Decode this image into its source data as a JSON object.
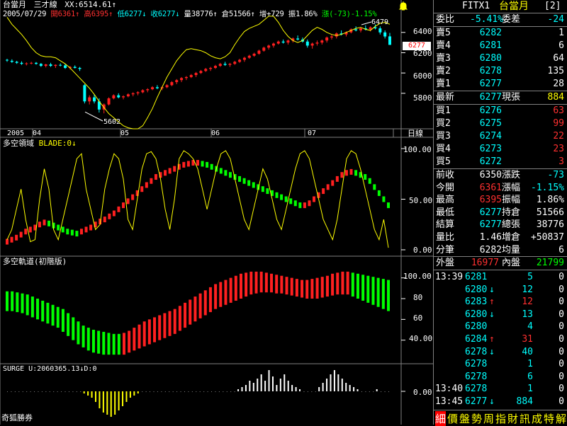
{
  "header": {
    "title": "台當月",
    "indicator": "三才線",
    "xx": "XX:6514.61↑",
    "date": "2005/07/29",
    "open": "開6361↑",
    "high": "高6395↑",
    "low": "低6277↓",
    "close": "收6277↓",
    "volume": "量38776↑",
    "oi": "倉51566↑",
    "oi_chg": "增+729",
    "amplitude": "振1.86%",
    "change": "漲(-73)-1.15%",
    "alert_icon": "bell-icon"
  },
  "price_chart": {
    "ymin": 5450,
    "ymax": 6580,
    "ticks": [
      "6400",
      "6200",
      "6000",
      "5800"
    ],
    "tick_values": [
      6400,
      6200,
      6000,
      5800
    ],
    "current_price": "6277",
    "high_label": "6479",
    "low_label": "5602",
    "months": [
      "2005",
      "04",
      "05",
      "06",
      "07"
    ],
    "period": "日線",
    "candles": [
      [
        6130,
        6140,
        6110,
        6125
      ],
      [
        6120,
        6135,
        6100,
        6110
      ],
      [
        6110,
        6120,
        6090,
        6100
      ],
      [
        6100,
        6115,
        6080,
        6090
      ],
      [
        6090,
        6105,
        6075,
        6095
      ],
      [
        6095,
        6110,
        6085,
        6100
      ],
      [
        6100,
        6108,
        6082,
        6090
      ],
      [
        6090,
        6098,
        6060,
        6070
      ],
      [
        6070,
        6090,
        6055,
        6085
      ],
      [
        6085,
        6100,
        6060,
        6070
      ],
      [
        6070,
        6085,
        6050,
        6080
      ],
      [
        6080,
        6095,
        6065,
        6075
      ],
      [
        6075,
        6090,
        6040,
        6050
      ],
      [
        6050,
        6070,
        6035,
        6060
      ],
      [
        6060,
        6075,
        6045,
        6050
      ],
      [
        6050,
        6060,
        6020,
        6040
      ],
      [
        5880,
        5890,
        5700,
        5720
      ],
      [
        5720,
        5780,
        5690,
        5760
      ],
      [
        5760,
        5790,
        5700,
        5720
      ],
      [
        5720,
        5750,
        5610,
        5640
      ],
      [
        5640,
        5700,
        5602,
        5690
      ],
      [
        5690,
        5760,
        5680,
        5750
      ],
      [
        5750,
        5790,
        5740,
        5780
      ],
      [
        5780,
        5800,
        5750,
        5760
      ],
      [
        5760,
        5780,
        5740,
        5770
      ],
      [
        5770,
        5800,
        5760,
        5790
      ],
      [
        5790,
        5810,
        5770,
        5800
      ],
      [
        5800,
        5820,
        5780,
        5810
      ],
      [
        5810,
        5840,
        5800,
        5830
      ],
      [
        5830,
        5850,
        5810,
        5840
      ],
      [
        5840,
        5870,
        5830,
        5860
      ],
      [
        5860,
        5880,
        5840,
        5850
      ],
      [
        5850,
        5870,
        5830,
        5860
      ],
      [
        5860,
        5890,
        5850,
        5880
      ],
      [
        5880,
        5920,
        5870,
        5910
      ],
      [
        5910,
        5940,
        5890,
        5930
      ],
      [
        5930,
        5960,
        5910,
        5950
      ],
      [
        5950,
        5970,
        5930,
        5960
      ],
      [
        5960,
        5990,
        5950,
        5980
      ],
      [
        5980,
        6010,
        5960,
        6000
      ],
      [
        6000,
        6030,
        5990,
        6020
      ],
      [
        6020,
        6050,
        6010,
        6040
      ],
      [
        6040,
        6060,
        6020,
        6050
      ],
      [
        6050,
        6080,
        6040,
        6070
      ],
      [
        6070,
        6100,
        6060,
        6090
      ],
      [
        6090,
        6110,
        6070,
        6080
      ],
      [
        6080,
        6100,
        6060,
        6090
      ],
      [
        6090,
        6120,
        6080,
        6110
      ],
      [
        6110,
        6140,
        6100,
        6130
      ],
      [
        6130,
        6160,
        6110,
        6150
      ],
      [
        6150,
        6180,
        6140,
        6170
      ],
      [
        6170,
        6200,
        6160,
        6190
      ],
      [
        6190,
        6230,
        6180,
        6220
      ],
      [
        6220,
        6260,
        6210,
        6250
      ],
      [
        6250,
        6280,
        6230,
        6270
      ],
      [
        6270,
        6300,
        6250,
        6290
      ],
      [
        6290,
        6320,
        6280,
        6310
      ],
      [
        6310,
        6330,
        6290,
        6300
      ],
      [
        6300,
        6330,
        6280,
        6320
      ],
      [
        6320,
        6350,
        6300,
        6340
      ],
      [
        6340,
        6370,
        6320,
        6330
      ],
      [
        6330,
        6350,
        6300,
        6310
      ],
      [
        6310,
        6330,
        6250,
        6270
      ],
      [
        6270,
        6300,
        6240,
        6290
      ],
      [
        6290,
        6320,
        6270,
        6300
      ],
      [
        6300,
        6330,
        6280,
        6320
      ],
      [
        6320,
        6360,
        6300,
        6350
      ],
      [
        6350,
        6380,
        6330,
        6360
      ],
      [
        6360,
        6400,
        6340,
        6390
      ],
      [
        6390,
        6420,
        6370,
        6380
      ],
      [
        6380,
        6410,
        6360,
        6400
      ],
      [
        6400,
        6440,
        6390,
        6430
      ],
      [
        6430,
        6460,
        6410,
        6420
      ],
      [
        6420,
        6450,
        6400,
        6440
      ],
      [
        6440,
        6470,
        6420,
        6430
      ],
      [
        6430,
        6460,
        6410,
        6450
      ],
      [
        6450,
        6479,
        6430,
        6440
      ],
      [
        6440,
        6460,
        6380,
        6400
      ],
      [
        6400,
        6420,
        6340,
        6360
      ],
      [
        6361,
        6395,
        6277,
        6277
      ]
    ],
    "ma_line": [
      6550,
      6480,
      6430,
      6380,
      6320,
      6250,
      6200,
      6170,
      6160,
      6160,
      6150,
      6120,
      6090,
      6050,
      6000,
      5950,
      5900,
      5850,
      5790,
      5720,
      5660,
      5600,
      5560,
      5520,
      5480,
      5460,
      5450,
      5450,
      5480,
      5560,
      5650,
      5760,
      5860,
      5960,
      6040,
      6120,
      6180,
      6230,
      6240,
      6230,
      6220,
      6200,
      6170,
      6150,
      6140,
      6160,
      6200,
      6280,
      6350,
      6410,
      6440,
      6460,
      6480,
      6520,
      6560,
      6560,
      6500,
      6420,
      6360,
      6320,
      6300,
      6320,
      6370,
      6420,
      6450,
      6430,
      6400,
      6380,
      6370,
      6380,
      6400,
      6420,
      6440,
      6450,
      6430,
      6420,
      6460,
      6490,
      6500,
      6480
    ]
  },
  "blade_chart": {
    "title": "多空領域",
    "param": "BLADE:0↓",
    "ticks": [
      "100.00",
      "50.00",
      "0.00"
    ],
    "tick_values": [
      100,
      50,
      0
    ],
    "dots": [
      8,
      10,
      12,
      15,
      18,
      20,
      22,
      25,
      27,
      26,
      24,
      22,
      20,
      18,
      17,
      16,
      18,
      20,
      22,
      25,
      28,
      30,
      33,
      36,
      40,
      44,
      48,
      52,
      56,
      60,
      64,
      68,
      72,
      74,
      76,
      78,
      80,
      82,
      84,
      85,
      86,
      86,
      85,
      84,
      82,
      80,
      78,
      76,
      74,
      72,
      70,
      68,
      66,
      64,
      62,
      60,
      58,
      56,
      54,
      52,
      50,
      48,
      46,
      44,
      44,
      46,
      50,
      54,
      58,
      62,
      66,
      70,
      74,
      76,
      77,
      76,
      74,
      72,
      68,
      62,
      56,
      50,
      44
    ],
    "line": [
      10,
      20,
      40,
      60,
      30,
      8,
      10,
      50,
      80,
      60,
      20,
      10,
      30,
      50,
      70,
      90,
      95,
      60,
      40,
      20,
      25,
      60,
      80,
      95,
      90,
      70,
      30,
      20,
      50,
      80,
      95,
      97,
      90,
      70,
      40,
      20,
      50,
      90,
      98,
      95,
      90,
      80,
      60,
      40,
      60,
      80,
      95,
      98,
      90,
      70,
      50,
      30,
      20,
      40,
      60,
      80,
      70,
      50,
      30,
      20,
      40,
      60,
      80,
      95,
      98,
      90,
      70,
      50,
      30,
      20,
      10,
      30,
      60,
      90,
      98,
      95,
      80,
      60,
      40,
      20,
      10,
      30,
      2
    ]
  },
  "track_chart": {
    "title": "多空軌道(初階版)",
    "ticks": [
      "100.00",
      "80",
      "60",
      "40.00"
    ],
    "tick_values": [
      100,
      80,
      60,
      40
    ],
    "bars": [
      [
        87,
        68
      ],
      [
        87,
        68
      ],
      [
        86,
        67
      ],
      [
        85,
        66
      ],
      [
        84,
        64
      ],
      [
        82,
        62
      ],
      [
        80,
        60
      ],
      [
        78,
        58
      ],
      [
        76,
        56
      ],
      [
        74,
        54
      ],
      [
        72,
        52
      ],
      [
        70,
        48
      ],
      [
        66,
        44
      ],
      [
        62,
        40
      ],
      [
        58,
        36
      ],
      [
        54,
        33
      ],
      [
        52,
        30
      ],
      [
        50,
        28
      ],
      [
        49,
        27
      ],
      [
        48,
        26
      ],
      [
        47,
        26
      ],
      [
        46,
        26
      ],
      [
        46,
        26
      ],
      [
        47,
        26
      ],
      [
        49,
        28
      ],
      [
        52,
        30
      ],
      [
        55,
        32
      ],
      [
        58,
        34
      ],
      [
        60,
        36
      ],
      [
        62,
        38
      ],
      [
        64,
        40
      ],
      [
        66,
        42
      ],
      [
        68,
        44
      ],
      [
        70,
        46
      ],
      [
        73,
        49
      ],
      [
        76,
        52
      ],
      [
        79,
        55
      ],
      [
        82,
        58
      ],
      [
        85,
        61
      ],
      [
        88,
        64
      ],
      [
        91,
        67
      ],
      [
        94,
        70
      ],
      [
        96,
        72
      ],
      [
        98,
        74
      ],
      [
        100,
        76
      ],
      [
        102,
        78
      ],
      [
        104,
        80
      ],
      [
        105,
        82
      ],
      [
        106,
        84
      ],
      [
        106,
        85
      ],
      [
        106,
        86
      ],
      [
        105,
        86
      ],
      [
        104,
        86
      ],
      [
        103,
        85
      ],
      [
        102,
        85
      ],
      [
        101,
        84
      ],
      [
        100,
        83
      ],
      [
        99,
        82
      ],
      [
        98,
        81
      ],
      [
        98,
        80
      ],
      [
        99,
        80
      ],
      [
        100,
        80
      ],
      [
        101,
        81
      ],
      [
        102,
        82
      ],
      [
        104,
        83
      ],
      [
        105,
        84
      ],
      [
        106,
        84
      ],
      [
        106,
        84
      ],
      [
        105,
        82
      ],
      [
        104,
        80
      ],
      [
        103,
        78
      ],
      [
        102,
        76
      ],
      [
        101,
        74
      ],
      [
        100,
        72
      ],
      [
        99,
        70
      ],
      [
        98,
        68
      ]
    ],
    "colors_split": [
      23,
      68
    ]
  },
  "surge_chart": {
    "title": "SURGE",
    "param": "U:2060365.13↓D:0",
    "zero_label": "0.00",
    "vals": [
      0,
      0,
      0,
      0,
      0,
      0,
      0,
      0,
      0,
      0,
      0,
      0,
      0,
      0,
      0,
      0,
      0,
      0,
      0,
      0,
      -1,
      -2,
      -3,
      -5,
      -8,
      -10,
      -11,
      -12,
      -11,
      -9,
      -7,
      -5,
      -3,
      -2,
      -1,
      0,
      0,
      0,
      0,
      0,
      0,
      0,
      0,
      0,
      0,
      0,
      0,
      0,
      0,
      0,
      0,
      0,
      0,
      0,
      0,
      0,
      0,
      0,
      0,
      0,
      1,
      2,
      3,
      5,
      4,
      6,
      8,
      5,
      10,
      7,
      3,
      6,
      8,
      5,
      3,
      2,
      1,
      0,
      0,
      0,
      0,
      2,
      4,
      6,
      8,
      10,
      8,
      6,
      4,
      3,
      2,
      1,
      0,
      0,
      0,
      0,
      1,
      0,
      0,
      0
    ]
  },
  "footer": {
    "brand": "奇狐勝券"
  },
  "quote_panel": {
    "symbol": "FITX1",
    "name": "台當月",
    "page": "[2]",
    "weibi_label": "委比",
    "weibi_val": "-5.41%",
    "weicha_label": "委差",
    "weicha_val": "-24",
    "asks": [
      {
        "label": "賣5",
        "price": "6282",
        "vol": "1"
      },
      {
        "label": "賣4",
        "price": "6281",
        "vol": "6"
      },
      {
        "label": "賣3",
        "price": "6280",
        "vol": "64"
      },
      {
        "label": "賣2",
        "price": "6278",
        "vol": "135"
      },
      {
        "label": "賣1",
        "price": "6277",
        "vol": "28"
      }
    ],
    "last_label": "最新",
    "last_price": "6277",
    "cur_vol_label": "現張",
    "cur_vol": "884",
    "bids": [
      {
        "label": "買1",
        "price": "6276",
        "vol": "63"
      },
      {
        "label": "買2",
        "price": "6275",
        "vol": "99"
      },
      {
        "label": "買3",
        "price": "6274",
        "vol": "22"
      },
      {
        "label": "買4",
        "price": "6273",
        "vol": "23"
      },
      {
        "label": "買5",
        "price": "6272",
        "vol": "3"
      }
    ],
    "stats": [
      {
        "l1": "前收",
        "v1": "6350",
        "l2": "漲跌",
        "v2": "-73"
      },
      {
        "l1": "今開",
        "v1": "6361",
        "l2": "漲幅",
        "v2": "-1.15%"
      },
      {
        "l1": "最高",
        "v1": "6395",
        "l2": "振幅",
        "v2": "1.86%"
      },
      {
        "l1": "最低",
        "v1": "6277",
        "l2": "持倉",
        "v2": "51566"
      },
      {
        "l1": "結算",
        "v1": "6277",
        "l2": "總張",
        "v2": "38776"
      },
      {
        "l1": "量比",
        "v1": "1.46",
        "l2": "增倉",
        "v2": "+50837"
      },
      {
        "l1": "分筆",
        "v1": "6282",
        "l2": "均量",
        "v2": "6"
      }
    ],
    "outer_label": "外盤",
    "outer_val": "16977",
    "inner_label": "內盤",
    "inner_val": "21799",
    "ticks": [
      {
        "time": "13:39",
        "price": "6281",
        "arrow": "",
        "vol": "5",
        "oi": "0"
      },
      {
        "time": "",
        "price": "6280",
        "arrow": "↓",
        "vol": "12",
        "oi": "0"
      },
      {
        "time": "",
        "price": "6283",
        "arrow": "↑",
        "vol": "12",
        "oi": "0"
      },
      {
        "time": "",
        "price": "6280",
        "arrow": "↓",
        "vol": "13",
        "oi": "0"
      },
      {
        "time": "",
        "price": "6280",
        "arrow": "",
        "vol": "4",
        "oi": "0"
      },
      {
        "time": "",
        "price": "6284",
        "arrow": "↑",
        "vol": "31",
        "oi": "0"
      },
      {
        "time": "",
        "price": "6278",
        "arrow": "↓",
        "vol": "40",
        "oi": "0"
      },
      {
        "time": "",
        "price": "6278",
        "arrow": "",
        "vol": "1",
        "oi": "0"
      },
      {
        "time": "",
        "price": "6278",
        "arrow": "",
        "vol": "6",
        "oi": "0"
      },
      {
        "time": "13:40",
        "price": "6278",
        "arrow": "",
        "vol": "1",
        "oi": "0"
      },
      {
        "time": "13:45",
        "price": "6277",
        "arrow": "↓",
        "vol": "884",
        "oi": "0"
      }
    ],
    "tabs": [
      "細",
      "價",
      "盤",
      "勢",
      "周",
      "指",
      "財",
      "訊",
      "成",
      "特",
      "解"
    ]
  }
}
